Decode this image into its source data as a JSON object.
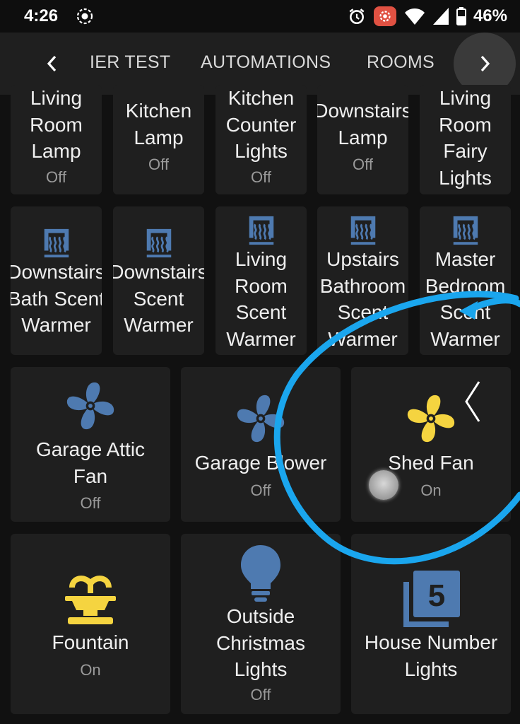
{
  "status_bar": {
    "time": "4:26",
    "battery_percent": "46%",
    "icons": [
      "screen-record-icon",
      "alarm-icon",
      "cast-icon",
      "wifi-icon",
      "signal-icon",
      "battery-icon"
    ]
  },
  "tabs": {
    "items": [
      {
        "label": "IER TEST"
      },
      {
        "label": "AUTOMATIONS"
      },
      {
        "label": "ROOMS"
      }
    ],
    "prev_icon": "chevron-left-icon",
    "next_icon": "chevron-right-icon"
  },
  "tiles": {
    "row1": [
      {
        "name": "Living\nRoom\nLamp",
        "state": "Off"
      },
      {
        "name": "Kitchen\nLamp",
        "state": "Off"
      },
      {
        "name": "Kitchen\nCounter\nLights",
        "state": "Off"
      },
      {
        "name": "Downstairs\nLamp",
        "state": "Off"
      },
      {
        "name": "Living\nRoom\nFairy\nLights",
        "state": ""
      }
    ],
    "row2": [
      {
        "name": "Downstairs\nBath Scent\nWarmer",
        "icon": "scent-warmer-icon"
      },
      {
        "name": "Downstairs\nScent\nWarmer",
        "icon": "scent-warmer-icon"
      },
      {
        "name": "Living\nRoom\nScent\nWarmer",
        "icon": "scent-warmer-icon"
      },
      {
        "name": "Upstairs\nBathroom\nScent\nWarmer",
        "icon": "scent-warmer-icon"
      },
      {
        "name": "Master\nBedroom\nScent\nWarmer",
        "icon": "scent-warmer-icon"
      }
    ],
    "row3": [
      {
        "name": "Garage Attic\nFan",
        "state": "Off",
        "icon": "fan-icon"
      },
      {
        "name": "Garage Blower",
        "state": "Off",
        "icon": "fan-icon"
      },
      {
        "name": "Shed Fan",
        "state": "On",
        "icon": "fan-icon"
      }
    ],
    "row4": [
      {
        "name": "Fountain",
        "state": "On",
        "icon": "fountain-icon"
      },
      {
        "name": "Outside\nChristmas\nLights",
        "state": "Off",
        "icon": "lightbulb-icon"
      },
      {
        "name": "House Number\nLights",
        "state": "",
        "icon": "house-number-icon"
      }
    ]
  },
  "colors": {
    "icon_off": "#4e7ab0",
    "icon_on": "#f5d440",
    "annotation": "#1aa6ee",
    "tile_bg": "#1f1f1f"
  }
}
